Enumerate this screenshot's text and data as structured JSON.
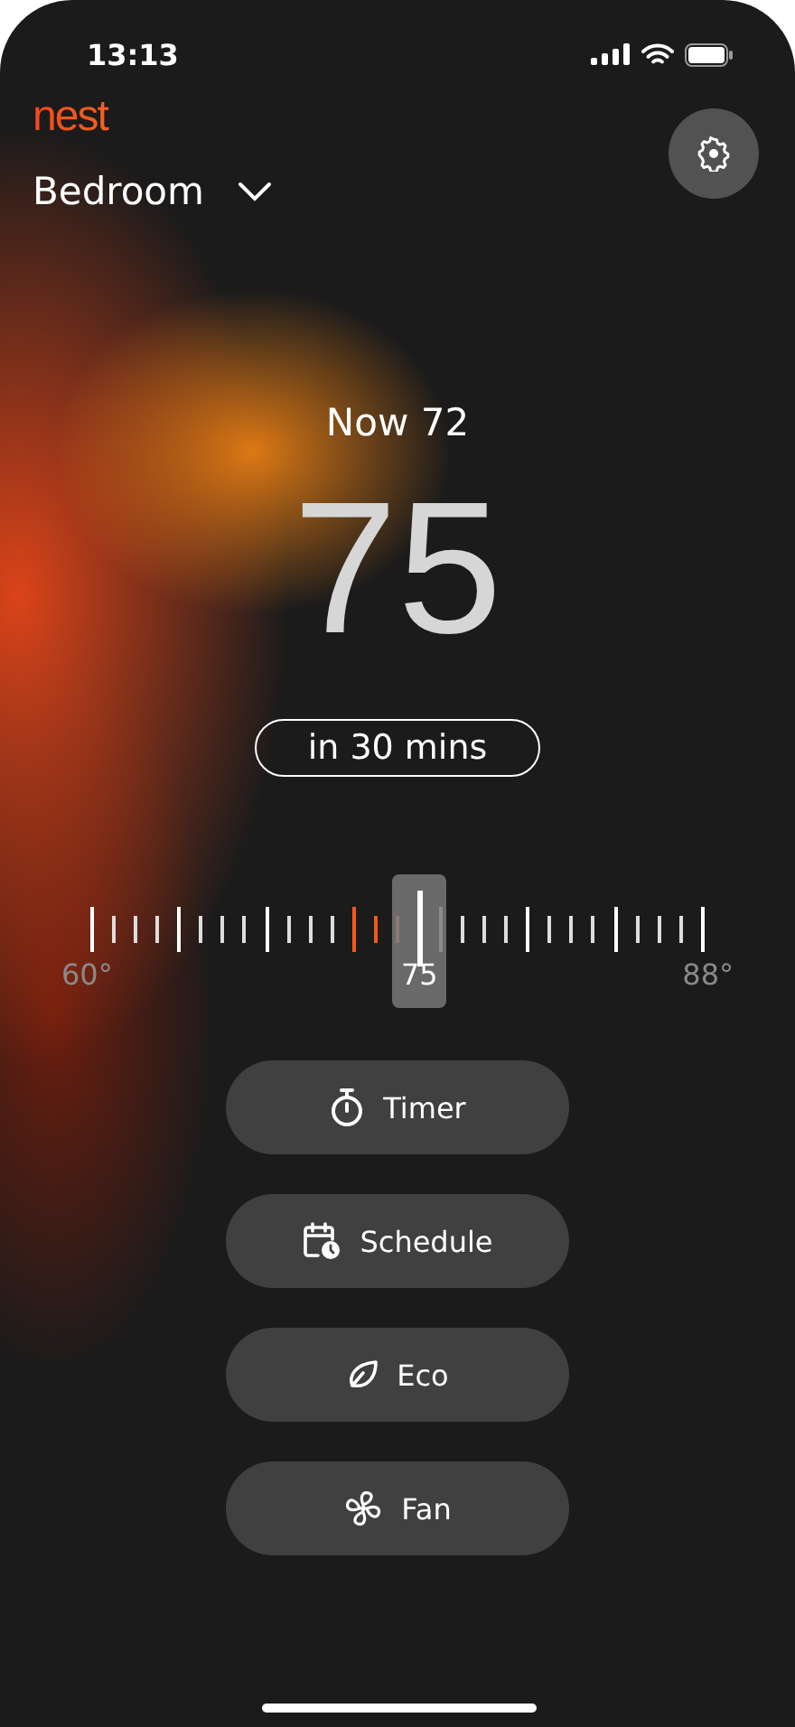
{
  "status_bar": {
    "time": "13:13"
  },
  "logo": "nest",
  "room": {
    "name": "Bedroom"
  },
  "current": "Now 72",
  "target": "75",
  "eta": "in 30 mins",
  "scale": {
    "min_label": "60°",
    "thumb_label": "75",
    "max_label": "88°"
  },
  "actions": [
    {
      "kind": "timer",
      "label": "Timer"
    },
    {
      "kind": "schedule",
      "label": "Schedule"
    },
    {
      "kind": "eco",
      "label": "Eco"
    },
    {
      "kind": "fan",
      "label": "Fan"
    }
  ]
}
